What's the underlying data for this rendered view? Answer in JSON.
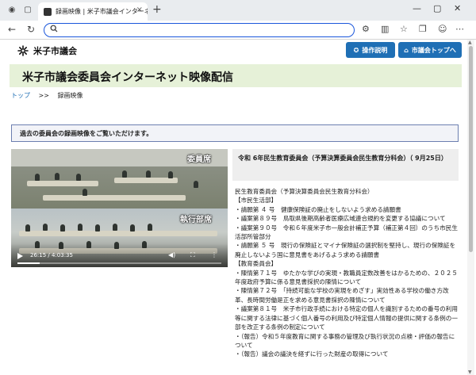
{
  "browser": {
    "tab_title": "録画映像 | 米子市議会インターネット映像",
    "url": ""
  },
  "header": {
    "logo_text": "米子市議会",
    "btn_guide": "操作説明",
    "btn_top": "市議会トップへ"
  },
  "banner": {
    "title": "米子市議会委員会インターネット映像配信"
  },
  "breadcrumb": {
    "home": "トップ",
    "sep": ">>",
    "current": "録画映像"
  },
  "notice": "過去の委員会の録画映像をご覧いただけます。",
  "video": {
    "caption_top": "委員席",
    "caption_bottom": "執行部席",
    "time": "26:15 / 4:03:35",
    "progress": 0.108
  },
  "session_title": "令和 6年民生教育委員会（予算決算委員会民生教育分科会）（ 9月25日）",
  "content_lines": [
    "民生教育委員会（予算決算委員会民生教育分科会）",
    "【市民生活部】",
    "・請願第 ４ 号　健康保険証の廃止をしないよう求める請願書",
    "・議案第８９号　鳥取県後期高齢者医療広域連合規約を変更する協議について",
    "・議案第９０号　令和６年度米子市一般会計補正予算（補正第４回）のうち市民生活部所管部分",
    "・請願第 ５ 号　現行の保険証とマイナ保険証の選択制を堅持し、現行の保険証を廃止しないよう国に意見書をあげるよう求める請願書",
    "【教育委員会】",
    "・陳情第７１号　ゆたかな学びの実現・教職員定数改善をはかるための、２０２５年度政府予算に係る意見書採択の陳情について",
    "・陳情第７２号　「持続可能な学校の実現をめざす」実効性ある学校の働き方改革、長時間労働是正を求める意見書採択の陳情について",
    "・議案第８１号　米子市行政手続における特定の個人を識別するための番号の利用等に関する法律に基づく個人番号の利用及び特定個人情報の提供に関する条例の一部を改正する条例の制定について",
    "・（報告）令和５年度教育に関する事務の管理及び執行状況の点検・評価の報告について",
    "・（報告）議会の議決を経ずに行った財産の取得について"
  ]
}
